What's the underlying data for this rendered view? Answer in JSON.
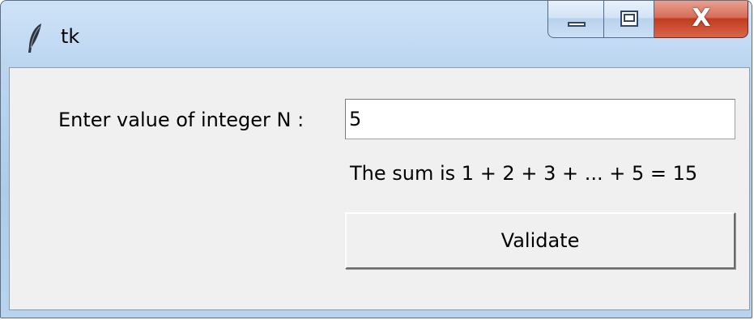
{
  "window": {
    "title": "tk",
    "close_glyph": "X"
  },
  "icons": {
    "app": "feather-icon",
    "minimize": "minimize-icon",
    "maximize": "maximize-icon",
    "close": "close-icon"
  },
  "form": {
    "n_label": "Enter value of integer N  :",
    "n_value": "5",
    "result_text": "The sum is  1 + 2 + 3 + ... + 5 = 15",
    "validate_label": "Validate"
  },
  "colors": {
    "client_bg": "#f0f0f0",
    "titlebar_blue": "#bcd6f0",
    "close_red": "#c23c1e"
  }
}
